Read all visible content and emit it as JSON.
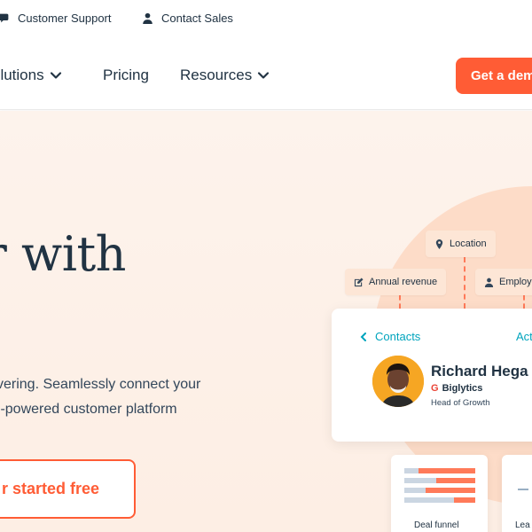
{
  "utility": {
    "support_label": "Customer Support",
    "sales_label": "Contact Sales"
  },
  "nav": {
    "solutions_label": "olutions",
    "pricing_label": "Pricing",
    "resources_label": "Resources",
    "demo_label": "Get a dem"
  },
  "hero": {
    "headline": "r with",
    "body_lines": [
      "vering. Seamlessly connect your",
      "I-powered customer platform"
    ],
    "cta_label": "r started free"
  },
  "tags": {
    "location": "Location",
    "revenue": "Annual revenue",
    "employ": "Employ"
  },
  "contact_card": {
    "back_label": "Contacts",
    "action_label": "Act",
    "name": "Richard Hega",
    "company_logo": "G",
    "company": "Biglytics",
    "role": "Head of Growth"
  },
  "mini_cards": {
    "funnel_label": "Deal funnel",
    "lead_label": "Lea",
    "funnel_fills": [
      0.8,
      0.55,
      0.7,
      0.3
    ]
  },
  "colors": {
    "accent": "#ff5c35",
    "teal": "#00a4bd",
    "text": "#213343",
    "hero_bg": "#fdf3ec"
  }
}
